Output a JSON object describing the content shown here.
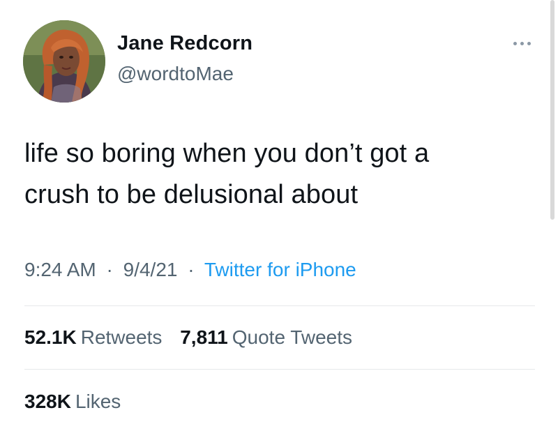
{
  "author": {
    "display_name": "Jane Redcorn",
    "handle": "@wordtoMae"
  },
  "tweet": {
    "text_lines": [
      "life so boring when you don’t got a",
      "crush to be delusional about"
    ]
  },
  "meta": {
    "time": "9:24 AM",
    "date": "9/4/21",
    "separator": "·",
    "source": "Twitter for iPhone"
  },
  "stats": {
    "retweets": {
      "count": "52.1K",
      "label": "Retweets"
    },
    "quote_tweets": {
      "count": "7,811",
      "label": "Quote Tweets"
    },
    "likes": {
      "count": "328K",
      "label": "Likes"
    }
  },
  "icons": {
    "more": "more-icon",
    "avatar": "avatar"
  },
  "colors": {
    "primary_text": "#0f1419",
    "secondary_text": "#536471",
    "link": "#1d9bf0",
    "divider": "#e6e8ea"
  }
}
